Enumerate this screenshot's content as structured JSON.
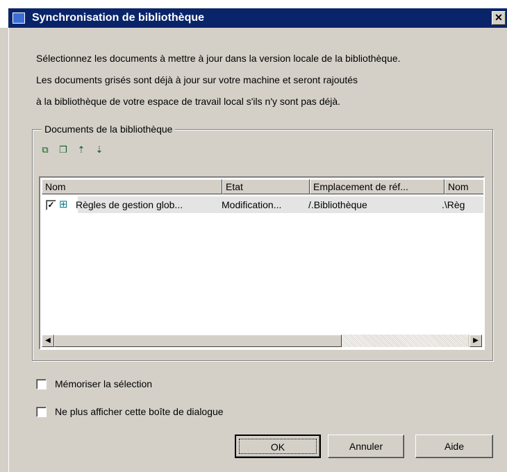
{
  "window": {
    "title": "Synchronisation de bibliothèque",
    "close_symbol": "✕"
  },
  "intro": [
    "Sélectionnez les documents à mettre à jour dans la version locale de la bibliothèque.",
    "Les documents grisés sont déjà à jour sur votre machine et seront rajoutés",
    "à la bibliothèque de votre espace de travail local s'ils n'y sont pas déjà."
  ],
  "group": {
    "label": "Documents de la bibliothèque",
    "toolbar": [
      "select-all-icon",
      "deselect-all-icon",
      "move-up-icon",
      "move-down-icon"
    ]
  },
  "list": {
    "columns": [
      "Nom",
      "Etat",
      "Emplacement de réf...",
      "Nom"
    ],
    "rows": [
      {
        "checked": "✓",
        "icon": "document-diagram-icon",
        "name": "Règles de gestion glob...",
        "state": "Modification...",
        "location": "/.Bibliothèque",
        "extra": ".\\Règ"
      }
    ]
  },
  "options": {
    "remember": "Mémoriser la sélection",
    "no_show": "Ne plus afficher cette boîte de dialogue"
  },
  "buttons": {
    "ok": "OK",
    "cancel": "Annuler",
    "help": "Aide"
  }
}
